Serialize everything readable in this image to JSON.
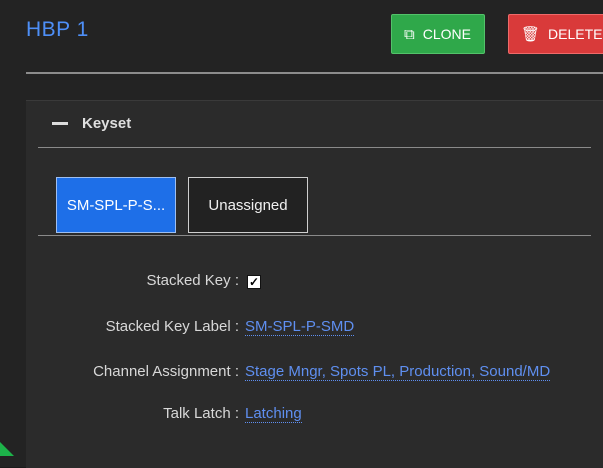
{
  "header": {
    "title": "HBP  1",
    "clone_label": "CLONE",
    "delete_label": "DELETE",
    "clone_icon": "copy-icon",
    "delete_icon": "trash-icon"
  },
  "panel": {
    "title": "Keyset",
    "tabs": [
      {
        "label": "SM-SPL-P-S...",
        "active": true
      },
      {
        "label": "Unassigned",
        "active": false
      }
    ]
  },
  "fields": {
    "stacked_key_label": "Stacked Key :",
    "stacked_key_checked": true,
    "stacked_key_label_label": "Stacked Key Label :",
    "stacked_key_label_value": "SM-SPL-P-SMD",
    "channel_assignment_label": "Channel Assignment :",
    "channel_assignment_value": "Stage Mngr, Spots PL, Production, Sound/MD",
    "talk_latch_label": "Talk Latch :",
    "talk_latch_value": "Latching"
  },
  "colors": {
    "accent": "#4e8ff7",
    "clone": "#2fa84a",
    "delete": "#d93a3a",
    "corner": "#1db34a"
  }
}
